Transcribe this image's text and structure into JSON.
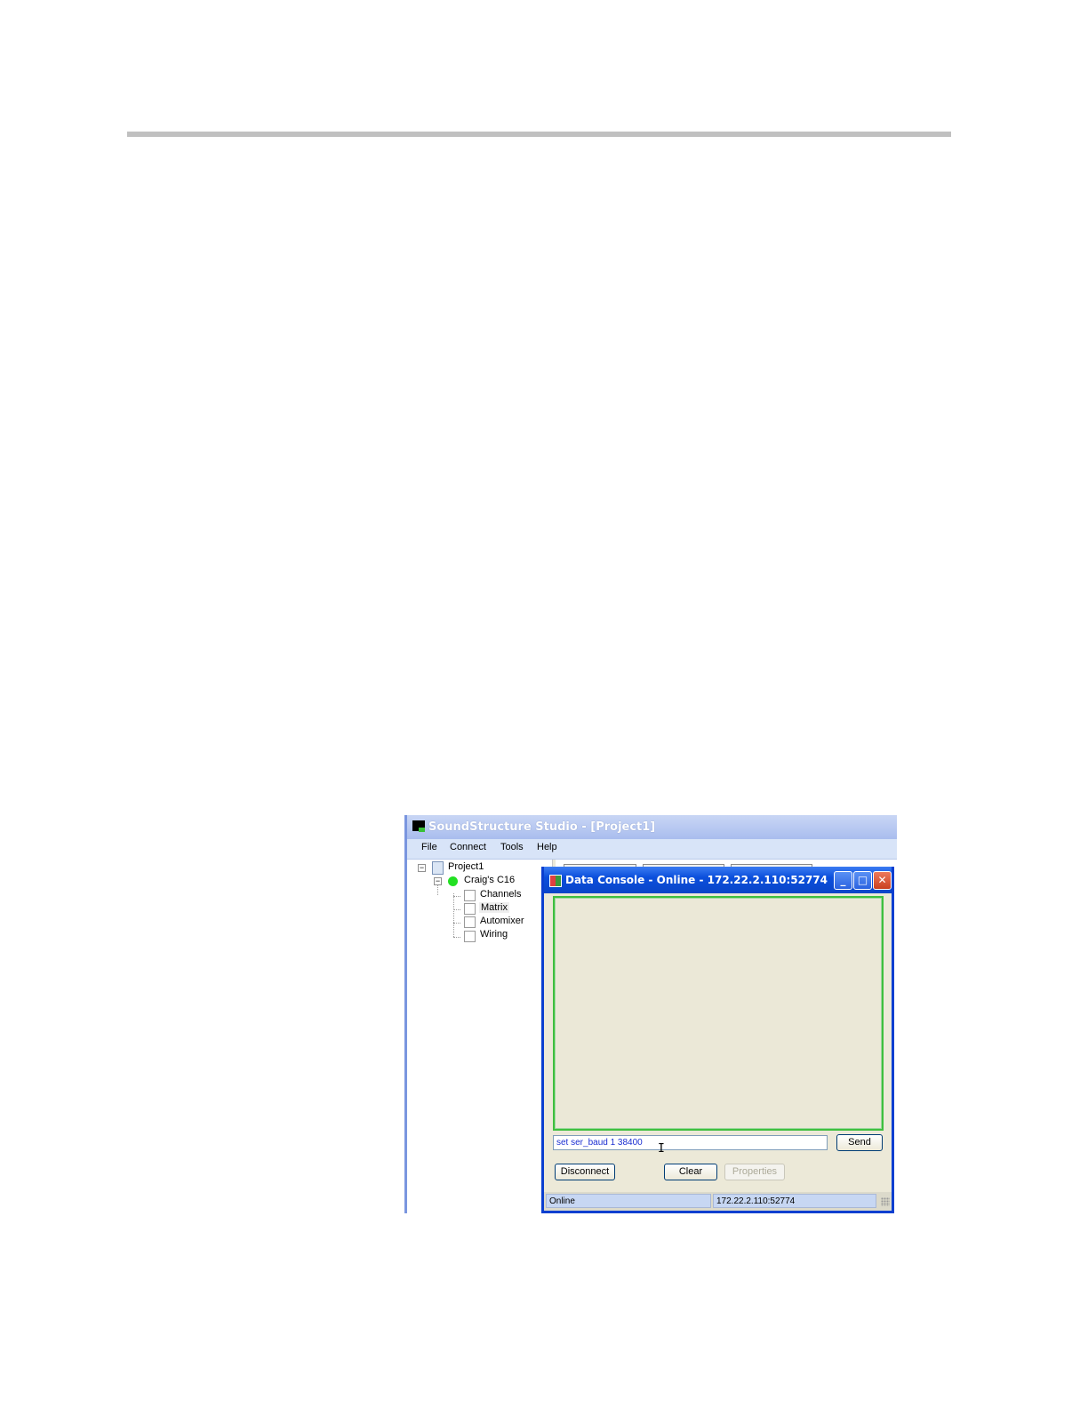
{
  "app": {
    "title": "SoundStructure Studio - [Project1]",
    "menu": [
      "File",
      "Connect",
      "Tools",
      "Help"
    ]
  },
  "tree": {
    "project": "Project1",
    "device": "Craig's C16",
    "items": [
      "Channels",
      "Matrix",
      "Automixer",
      "Wiring"
    ],
    "expand_glyph": "−"
  },
  "console": {
    "title": "Data Console - Online - 172.22.2.110:52774",
    "window_buttons": {
      "minimize": "_",
      "maximize": "□",
      "close": "✕"
    },
    "input_value": "set ser_baud 1 38400",
    "cursor_glyph": "I",
    "send_label": "Send",
    "disconnect_label": "Disconnect",
    "clear_label": "Clear",
    "properties_label": "Properties",
    "status_left": "Online",
    "status_right": "172.22.2.110:52774"
  },
  "colors": {
    "dialog_titlebar": "#0b4fdc",
    "output_border": "#3fbf3f",
    "online_indicator": "#22e022"
  }
}
